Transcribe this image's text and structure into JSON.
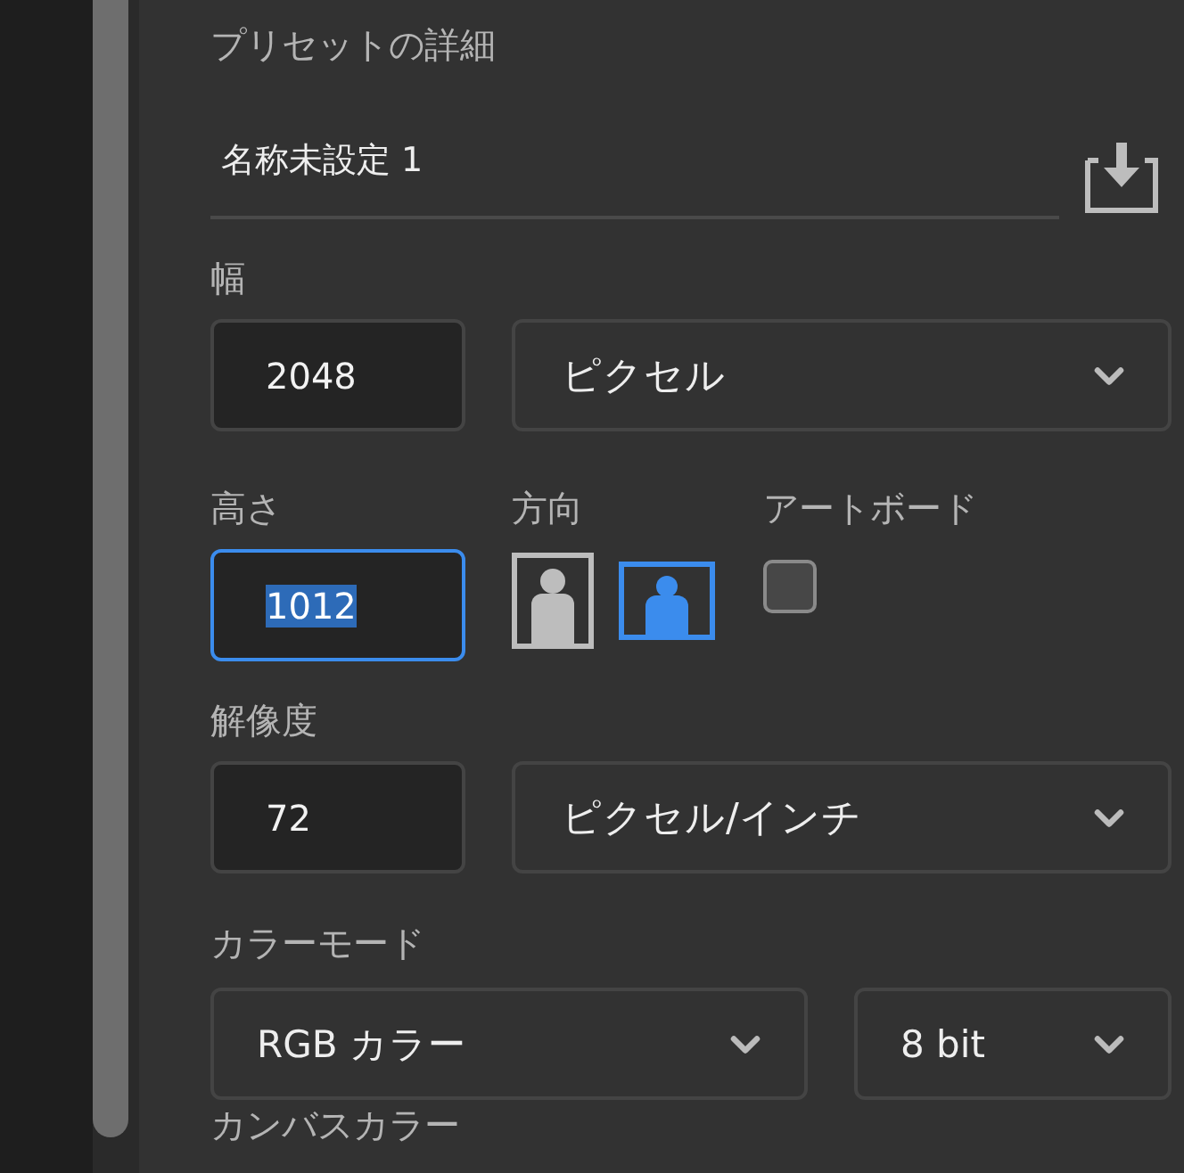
{
  "preset_details": {
    "title": "プリセットの詳細",
    "name": {
      "value": "名称未設定 1"
    },
    "width": {
      "label": "幅",
      "value": "2048",
      "focused": false,
      "unit": "ピクセル"
    },
    "height": {
      "label": "高さ",
      "value": "1012",
      "focused": true,
      "text_selected": true
    },
    "orientation": {
      "label": "方向",
      "options": [
        {
          "kind": "portrait",
          "selected": false
        },
        {
          "kind": "landscape",
          "selected": true
        }
      ]
    },
    "artboard": {
      "label": "アートボード",
      "checked": false
    },
    "resolution": {
      "label": "解像度",
      "value": "72",
      "focused": false,
      "unit": "ピクセル/インチ"
    },
    "color_mode": {
      "label": "カラーモード",
      "mode": "RGB カラー",
      "depth": "8 bit"
    },
    "canvas_color": {
      "label": "カンバスカラー"
    }
  }
}
